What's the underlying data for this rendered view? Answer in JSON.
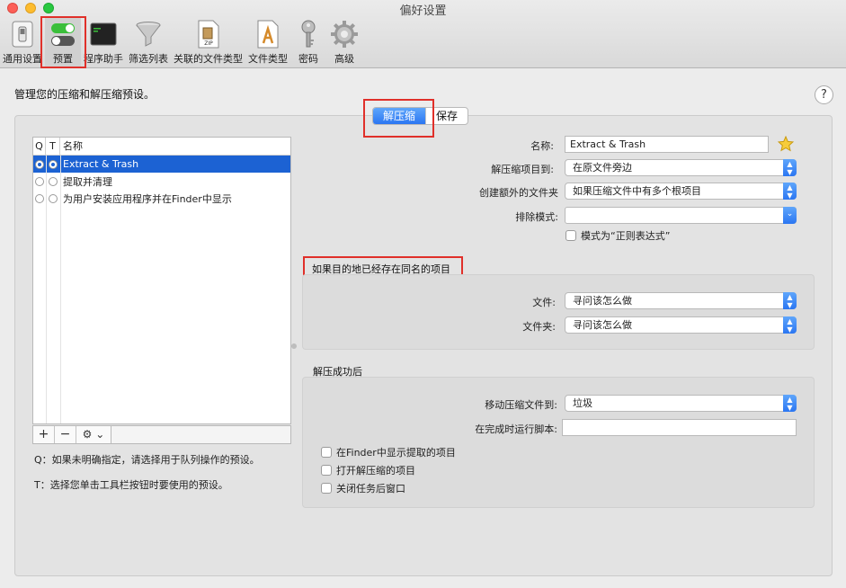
{
  "window": {
    "title": "偏好设置"
  },
  "toolbar": {
    "items": [
      {
        "label": "通用设置",
        "icon": "general-switch-icon"
      },
      {
        "label": "预置",
        "icon": "toggle-switches-icon"
      },
      {
        "label": "程序助手",
        "icon": "terminal-icon"
      },
      {
        "label": "筛选列表",
        "icon": "funnel-icon"
      },
      {
        "label": "关联的文件类型",
        "icon": "zip-file-icon"
      },
      {
        "label": "文件类型",
        "icon": "document-app-icon"
      },
      {
        "label": "密码",
        "icon": "key-icon"
      },
      {
        "label": "高级",
        "icon": "gear-icon"
      }
    ],
    "selected": "预置"
  },
  "description": "管理您的压缩和解压缩预设。",
  "help_label": "?",
  "tabs": {
    "extract": "解压缩",
    "save": "保存",
    "active": "解压缩"
  },
  "preset_list": {
    "columns": {
      "q": "Q",
      "t": "T",
      "name": "名称"
    },
    "rows": [
      {
        "name": "Extract & Trash",
        "q": true,
        "t": true,
        "selected": true
      },
      {
        "name": "提取并清理",
        "q": false,
        "t": false,
        "selected": false
      },
      {
        "name": "为用户安装应用程序并在Finder中显示",
        "q": false,
        "t": false,
        "selected": false
      }
    ],
    "add_label": "+",
    "remove_label": "−",
    "action_label": "⚙ ⌄"
  },
  "notes": {
    "q": "Q：如果未明确指定，请选择用于队列操作的预设。",
    "t": "T：选择您单击工具栏按钮时要使用的预设。"
  },
  "form": {
    "name_label": "名称:",
    "name_value": "Extract & Trash",
    "extract_to_label": "解压缩项目到:",
    "extract_to_value": "在原文件旁边",
    "create_folder_label": "创建额外的文件夹",
    "create_folder_value": "如果压缩文件中有多个根项目",
    "exclude_label": "排除模式:",
    "exclude_value": "",
    "regex_label": "模式为“正则表达式”",
    "regex_checked": false
  },
  "conflict_group": {
    "title": "如果目的地已经存在同名的项目",
    "file_label": "文件:",
    "file_value": "寻问该怎么做",
    "folder_label": "文件夹:",
    "folder_value": "寻问该怎么做"
  },
  "after_group": {
    "title": "解压成功后",
    "move_label": "移动压缩文件到:",
    "move_value": "垃圾",
    "script_label": "在完成时运行脚本:",
    "script_value": "",
    "show_in_finder": "在Finder中显示提取的项目",
    "open_extracted": "打开解压缩的项目",
    "close_window": "关闭任务后窗口"
  },
  "colors": {
    "accent": "#2b76f2",
    "selection": "#1c62d3",
    "highlight": "#e0302a"
  }
}
